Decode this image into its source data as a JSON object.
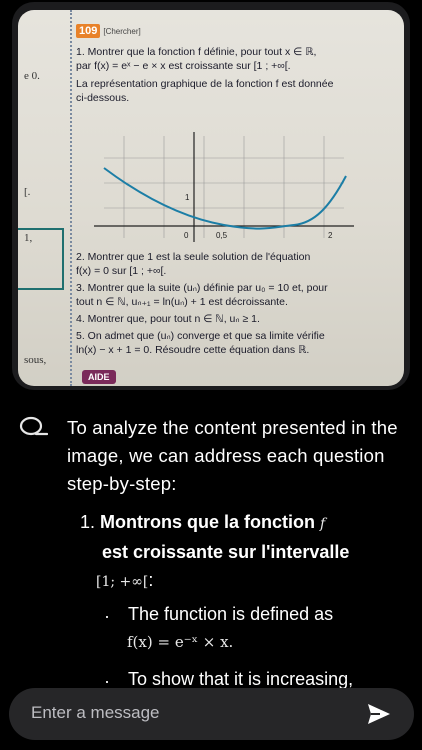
{
  "photo": {
    "edge_labels": [
      "e 0.",
      "[.",
      "1,",
      "sous,"
    ],
    "exercise_number": "109",
    "exercise_tag": "[Chercher]",
    "q1_line1": "1. Montrer que la fonction f définie, pour tout x ∈ ℝ,",
    "q1_line2": "par f(x) = eˣ − e × x est croissante sur [1 ; +∞[.",
    "q1_line3": "La représentation graphique de la fonction f est donnée",
    "q1_line4": "ci-dessous.",
    "graph_ticks": [
      "0",
      "0,5",
      "2",
      "1"
    ],
    "q2_line1": "2. Montrer que 1 est la seule solution de l'équation",
    "q2_line2": "f(x) = 0 sur [1 ; +∞[.",
    "q3_line1": "3. Montrer que la suite (uₙ) définie par u₀ = 10 et, pour",
    "q3_line2": "tout n ∈ ℕ, uₙ₊₁ = ln(uₙ) + 1 est décroissante.",
    "q4_line1": "4. Montrer que, pour tout n ∈ ℕ, uₙ ≥ 1.",
    "q5_line1": "5. On admet que (uₙ) converge et que sa limite vérifie",
    "q5_line2": "ln(x) − x + 1 = 0. Résoudre cette équation dans ℝ.",
    "aide": "AIDE"
  },
  "answer": {
    "intro": "To analyze the content presented in the image, we can address each question step-by-step:",
    "item1_number": "1.",
    "item1_title_a": "Montrons que la fonction ",
    "item1_title_f": "f",
    "item1_title_b": " est croissante sur l'intervalle",
    "item1_interval": "[1; +∞[",
    "item1_colon": ":",
    "bullet1_text": "The function is defined as",
    "bullet1_math": "f(x) = e⁻ˣ × x.",
    "bullet2_text": "To show that it is increasing,"
  },
  "input": {
    "placeholder": "Enter a message"
  }
}
